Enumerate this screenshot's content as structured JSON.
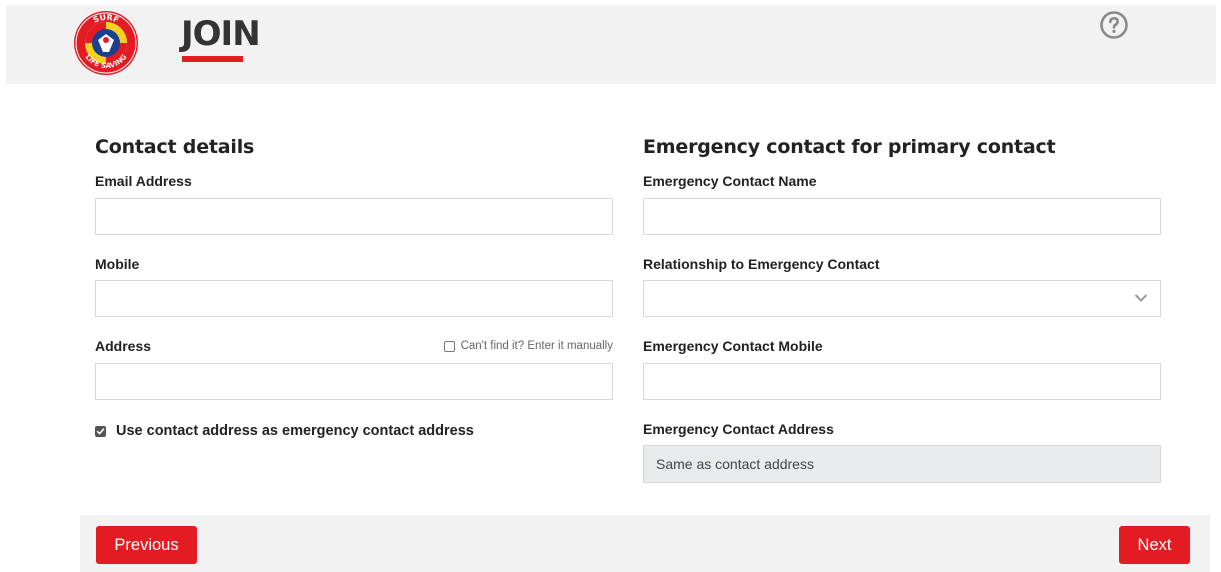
{
  "header": {
    "title": "JOIN",
    "logo_text_top": "SURF",
    "logo_text_bottom": "LIFE SAVING",
    "help_icon": "help-circle-icon",
    "accent_color": "#e31b23"
  },
  "contact": {
    "section_title": "Contact details",
    "email_label": "Email Address",
    "email_value": "",
    "mobile_label": "Mobile",
    "mobile_value": "",
    "address_label": "Address",
    "address_value": "",
    "manual_entry_label": "Can't find it? Enter it manually",
    "manual_entry_checked": false,
    "use_address_label": "Use contact address as emergency contact address",
    "use_address_checked": true
  },
  "emergency": {
    "section_title": "Emergency contact for primary contact",
    "name_label": "Emergency Contact Name",
    "name_value": "",
    "relationship_label": "Relationship to Emergency Contact",
    "relationship_value": "",
    "mobile_label": "Emergency Contact Mobile",
    "mobile_value": "",
    "address_label": "Emergency Contact Address",
    "address_value": "Same as contact address"
  },
  "footer": {
    "previous_label": "Previous",
    "next_label": "Next"
  }
}
